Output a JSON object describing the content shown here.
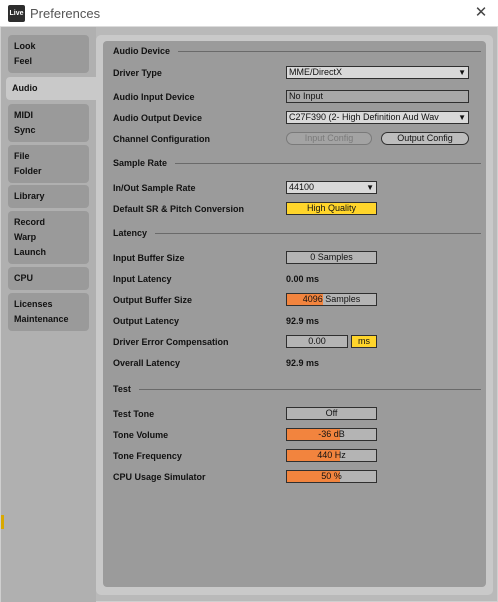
{
  "window": {
    "title": "Preferences",
    "app_icon": "Live"
  },
  "sidebar": {
    "items": [
      {
        "lines": [
          "Look",
          "Feel"
        ]
      },
      {
        "lines": [
          "Audio"
        ]
      },
      {
        "lines": [
          "MIDI",
          "Sync"
        ]
      },
      {
        "lines": [
          "File",
          "Folder"
        ]
      },
      {
        "lines": [
          "Library"
        ]
      },
      {
        "lines": [
          "Record",
          "Warp",
          "Launch"
        ]
      },
      {
        "lines": [
          "CPU"
        ]
      },
      {
        "lines": [
          "Licenses",
          "Maintenance"
        ]
      }
    ],
    "active": "Audio"
  },
  "audio_device": {
    "title": "Audio Device",
    "driver_type": {
      "label": "Driver Type",
      "value": "MME/DirectX"
    },
    "input_device": {
      "label": "Audio Input Device",
      "value": "No Input"
    },
    "output_device": {
      "label": "Audio Output Device",
      "value": "C27F390 (2- High Definition Aud Wav"
    },
    "channel_config": {
      "label": "Channel Configuration",
      "input_button": "Input Config",
      "output_button": "Output Config"
    }
  },
  "sample_rate": {
    "title": "Sample Rate",
    "in_out": {
      "label": "In/Out Sample Rate",
      "value": "44100"
    },
    "default_sr": {
      "label": "Default SR & Pitch Conversion",
      "value": "High Quality"
    }
  },
  "latency": {
    "title": "Latency",
    "input_buffer": {
      "label": "Input Buffer Size",
      "value": "0 Samples",
      "fill": 0
    },
    "input_latency": {
      "label": "Input Latency",
      "value": "0.00 ms"
    },
    "output_buffer": {
      "label": "Output Buffer Size",
      "value": "4096 Samples",
      "fill": 0.4
    },
    "output_latency": {
      "label": "Output Latency",
      "value": "92.9 ms"
    },
    "driver_error": {
      "label": "Driver Error Compensation",
      "value": "0.00",
      "unit": "ms"
    },
    "overall_latency": {
      "label": "Overall Latency",
      "value": "92.9 ms"
    }
  },
  "test": {
    "title": "Test",
    "tone": {
      "label": "Test Tone",
      "value": "Off"
    },
    "volume": {
      "label": "Tone Volume",
      "value": "-36 dB",
      "fill": 0.6
    },
    "frequency": {
      "label": "Tone Frequency",
      "value": "440 Hz",
      "fill": 0.6
    },
    "cpu_sim": {
      "label": "CPU Usage Simulator",
      "value": "50 %",
      "fill": 0.6
    }
  },
  "colors": {
    "accent_orange": "#f2843e",
    "highlight_yellow": "#ffd52b"
  },
  "icons": {
    "close": "close-icon",
    "dropdown": "dropdown-arrow-icon"
  }
}
